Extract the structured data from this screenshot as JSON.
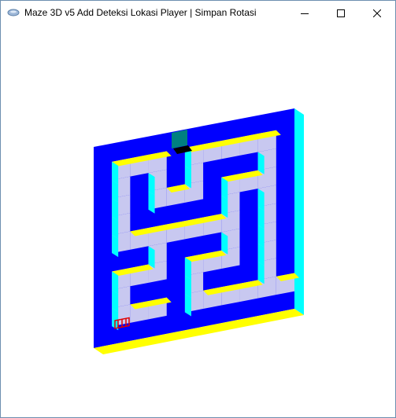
{
  "window": {
    "title": "Maze 3D v5 Add Deteksi Lokasi Player | Simpan Rotasi",
    "controls": [
      "minimize",
      "maximize",
      "close"
    ]
  },
  "maze": {
    "grid_size": "11x11",
    "player_marker": "person-icon",
    "player_color": "#e00000",
    "exit_marker": "exit-door",
    "colors": {
      "wall_top": "#0000ff",
      "wall_side_light": "#00ffff",
      "wall_side_front": "#ffff00",
      "floor": "#c8c8f0",
      "exit": "#008080",
      "exit_shadow": "#000000"
    }
  }
}
